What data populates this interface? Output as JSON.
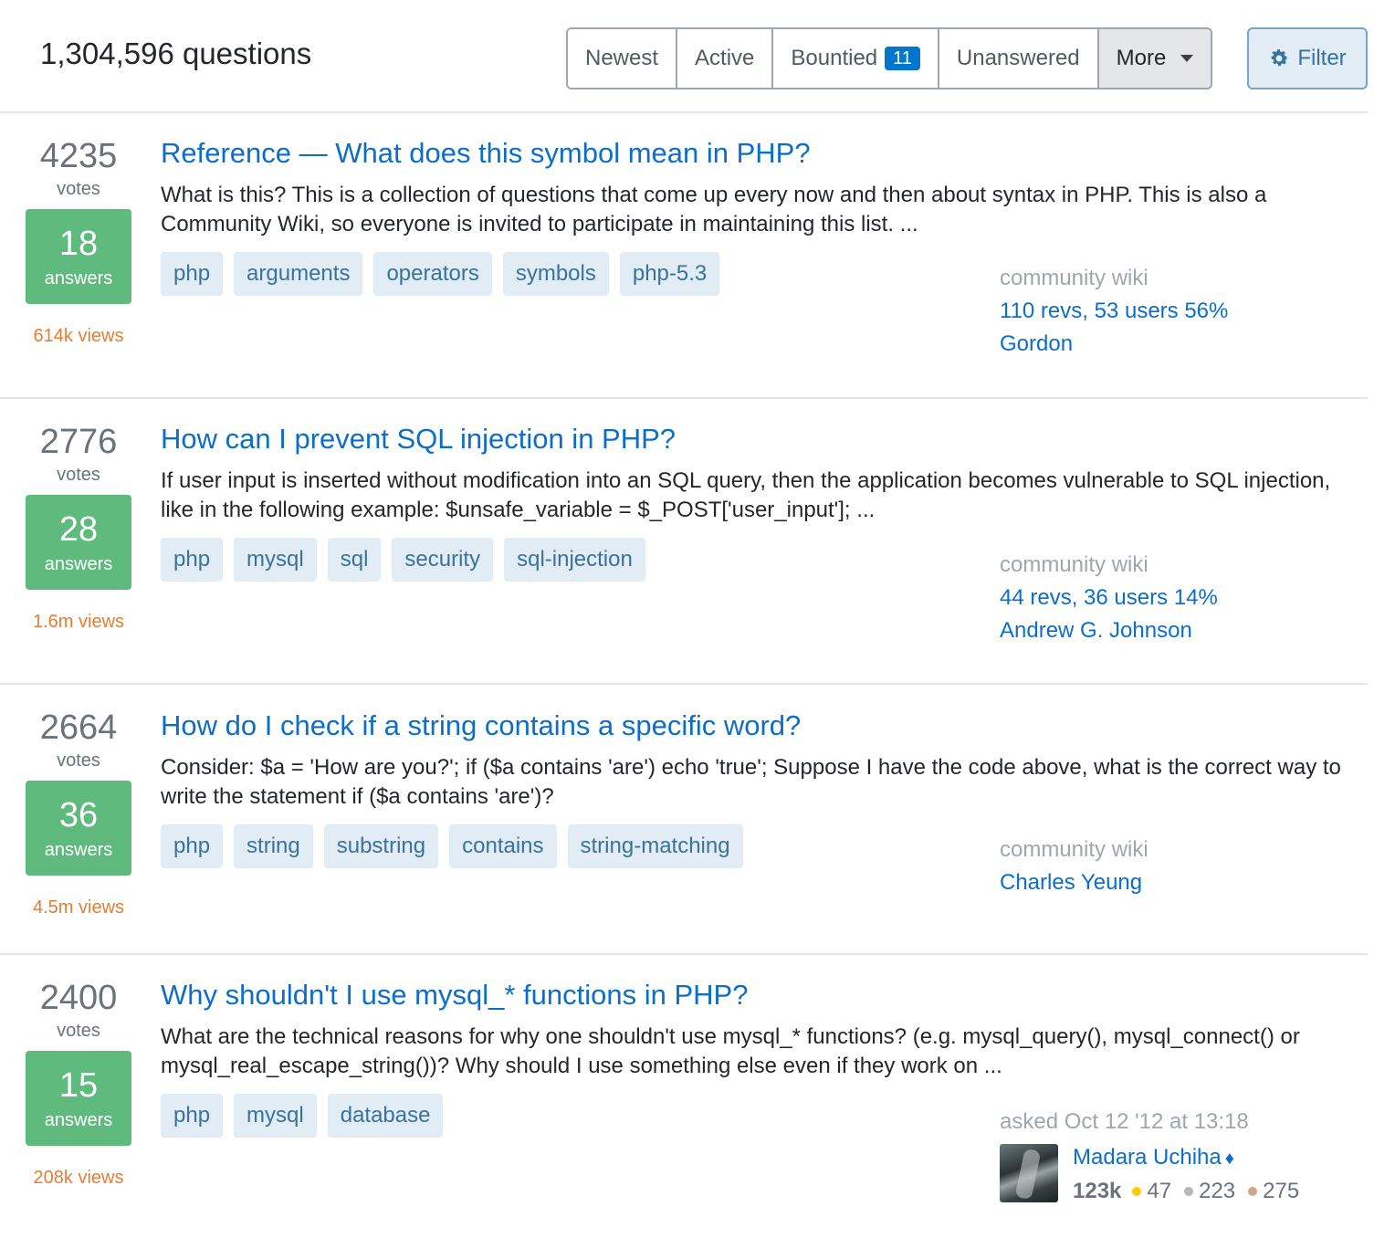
{
  "header": {
    "question_count": "1,304,596 questions",
    "tabs": [
      {
        "label": "Newest"
      },
      {
        "label": "Active"
      },
      {
        "label": "Bountied",
        "badge": "11"
      },
      {
        "label": "Unanswered"
      },
      {
        "label": "More"
      }
    ],
    "filter_label": "Filter"
  },
  "questions": [
    {
      "votes": "4235",
      "votes_label": "votes",
      "answers": "18",
      "answers_label": "answers",
      "views": "614k views",
      "title": "Reference — What does this symbol mean in PHP?",
      "excerpt": "What is this? This is a collection of questions that come up every now and then about syntax in PHP. This is also a Community Wiki, so everyone is invited to participate in maintaining this list. ...",
      "tags": [
        "php",
        "arguments",
        "operators",
        "symbols",
        "php-5.3"
      ],
      "owner": {
        "type": "community wiki",
        "revs": "110 revs, 53 users 56%",
        "user": "Gordon"
      }
    },
    {
      "votes": "2776",
      "votes_label": "votes",
      "answers": "28",
      "answers_label": "answers",
      "views": "1.6m views",
      "title": "How can I prevent SQL injection in PHP?",
      "excerpt": "If user input is inserted without modification into an SQL query, then the application becomes vulnerable to SQL injection, like in the following example: $unsafe_variable = $_POST['user_input']; ...",
      "tags": [
        "php",
        "mysql",
        "sql",
        "security",
        "sql-injection"
      ],
      "owner": {
        "type": "community wiki",
        "revs": "44 revs, 36 users 14%",
        "user": "Andrew G. Johnson"
      }
    },
    {
      "votes": "2664",
      "votes_label": "votes",
      "answers": "36",
      "answers_label": "answers",
      "views": "4.5m views",
      "title": "How do I check if a string contains a specific word?",
      "excerpt": "Consider: $a = 'How are you?'; if ($a contains 'are') echo 'true'; Suppose I have the code above, what is the correct way to write the statement if ($a contains 'are')?",
      "tags": [
        "php",
        "string",
        "substring",
        "contains",
        "string-matching"
      ],
      "owner": {
        "type": "community wiki",
        "user": "Charles Yeung"
      }
    },
    {
      "votes": "2400",
      "votes_label": "votes",
      "answers": "15",
      "answers_label": "answers",
      "views": "208k views",
      "title": "Why shouldn't I use mysql_* functions in PHP?",
      "excerpt": "What are the technical reasons for why one shouldn't use mysql_* functions? (e.g. mysql_query(), mysql_connect() or mysql_real_escape_string())? Why should I use something else even if they work on ...",
      "tags": [
        "php",
        "mysql",
        "database"
      ],
      "owner": {
        "asked": "asked Oct 12 '12 at 13:18",
        "user": "Madara Uchiha",
        "moderator_mark": "♦",
        "reputation": "123k",
        "gold": "47",
        "silver": "223",
        "bronze": "275"
      }
    }
  ],
  "colors": {
    "gold": "#ffcc01",
    "silver": "#b4b8bc",
    "bronze": "#d1a684",
    "answered": "#5eba7d",
    "link": "#0c6ec9",
    "views": "#e67d34"
  }
}
